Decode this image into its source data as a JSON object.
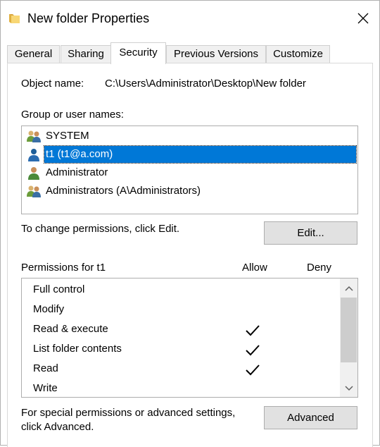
{
  "window": {
    "title": "New folder Properties"
  },
  "tabs": [
    {
      "label": "General"
    },
    {
      "label": "Sharing"
    },
    {
      "label": "Security"
    },
    {
      "label": "Previous Versions"
    },
    {
      "label": "Customize"
    }
  ],
  "security": {
    "object_name_label": "Object name:",
    "object_name_value": "C:\\Users\\Administrator\\Desktop\\New folder",
    "group_label": "Group or user names:",
    "groups": [
      {
        "name": "SYSTEM",
        "icon": "group-users-icon"
      },
      {
        "name": "t1 (t1@a.com)",
        "icon": "user-icon",
        "selected": true
      },
      {
        "name": "Administrator",
        "icon": "user-icon"
      },
      {
        "name": "Administrators (A\\Administrators)",
        "icon": "group-users-icon"
      }
    ],
    "change_text": "To change permissions, click Edit.",
    "edit_button": "Edit...",
    "permissions_label": "Permissions for t1",
    "allow_header": "Allow",
    "deny_header": "Deny",
    "permissions": [
      {
        "name": "Full control",
        "allow": false,
        "deny": false
      },
      {
        "name": "Modify",
        "allow": false,
        "deny": false
      },
      {
        "name": "Read & execute",
        "allow": true,
        "deny": false
      },
      {
        "name": "List folder contents",
        "allow": true,
        "deny": false
      },
      {
        "name": "Read",
        "allow": true,
        "deny": false
      },
      {
        "name": "Write",
        "allow": false,
        "deny": false
      }
    ],
    "special_text_line1": "For special permissions or advanced settings,",
    "special_text_line2": "click Advanced.",
    "advanced_button": "Advanced"
  },
  "colors": {
    "selection": "#0078d7",
    "button_bg": "#e1e1e1",
    "folder": "#f8d775"
  }
}
